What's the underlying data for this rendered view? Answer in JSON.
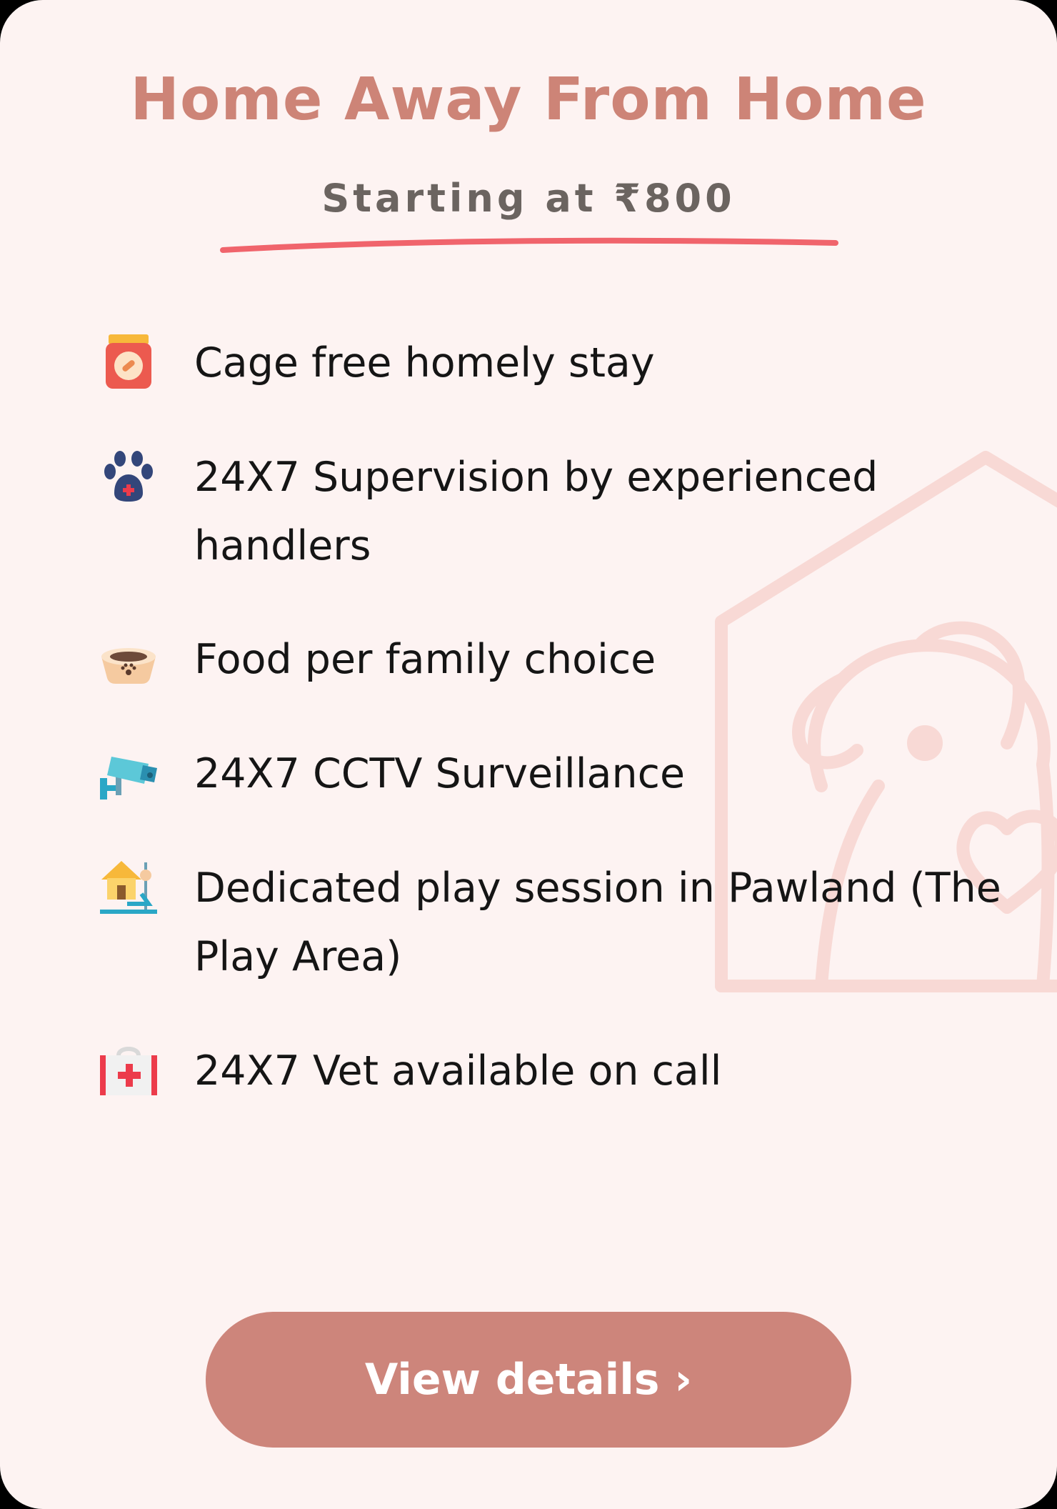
{
  "card": {
    "title": "Home Away From Home",
    "subtitle": "Starting at ₹800"
  },
  "features": [
    {
      "icon": "pet-food-bag-icon",
      "text": "Cage free homely stay"
    },
    {
      "icon": "paw-print-icon",
      "text": "24X7 Supervision by experienced handlers"
    },
    {
      "icon": "pet-bowl-icon",
      "text": "Food per family choice"
    },
    {
      "icon": "cctv-camera-icon",
      "text": "24X7 CCTV Surveillance"
    },
    {
      "icon": "play-area-icon",
      "text": "Dedicated play session in Pawland (The Play Area)"
    },
    {
      "icon": "first-aid-kit-icon",
      "text": "24X7 Vet available on call"
    }
  ],
  "cta": {
    "label": "View details ›"
  },
  "colors": {
    "card_background": "#fdf3f2",
    "title": "#cd8477",
    "underline": "#f0646c",
    "button": "#cd857b",
    "watermark": "#f8d9d5"
  }
}
